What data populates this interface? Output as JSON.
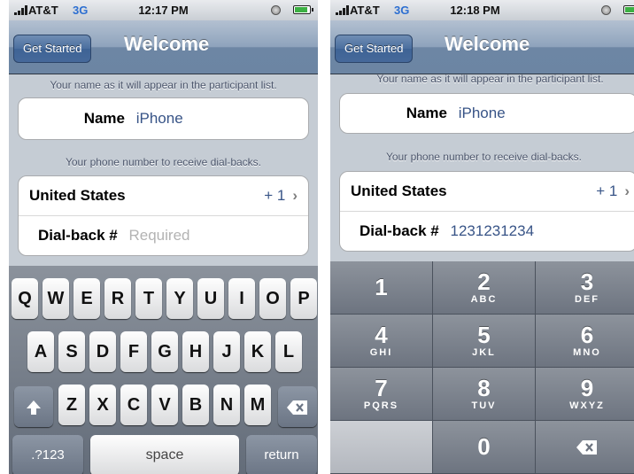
{
  "left": {
    "status": {
      "carrier": "AT&T",
      "network": "3G",
      "time": "12:17 PM"
    },
    "nav": {
      "button": "Get Started",
      "title": "Welcome"
    },
    "name_hint": "Your name as it will appear in the participant list.",
    "name": {
      "label": "Name",
      "value": "iPhone"
    },
    "phone_hint": "Your phone number to receive dial-backs.",
    "country": {
      "label": "United States",
      "code": "+ 1"
    },
    "dialback": {
      "label": "Dial-back #",
      "placeholder": "Required"
    },
    "keyboard": {
      "row1": [
        "Q",
        "W",
        "E",
        "R",
        "T",
        "Y",
        "U",
        "I",
        "O",
        "P"
      ],
      "row2": [
        "A",
        "S",
        "D",
        "F",
        "G",
        "H",
        "J",
        "K",
        "L"
      ],
      "row3": [
        "Z",
        "X",
        "C",
        "V",
        "B",
        "N",
        "M"
      ],
      "mode_key": ".?123",
      "space_key": "space",
      "return_key": "return"
    }
  },
  "right": {
    "status": {
      "carrier": "AT&T",
      "network": "3G",
      "time": "12:18 PM"
    },
    "nav": {
      "button": "Get Started",
      "title": "Welcome"
    },
    "name_hint": "Your name as it will appear in the participant list.",
    "name": {
      "label": "Name",
      "value": "iPhone"
    },
    "phone_hint": "Your phone number to receive dial-backs.",
    "country": {
      "label": "United States",
      "code": "+ 1"
    },
    "dialback": {
      "label": "Dial-back #",
      "value": "1231231234"
    },
    "keypad": [
      {
        "digit": "1",
        "letters": ""
      },
      {
        "digit": "2",
        "letters": "ABC"
      },
      {
        "digit": "3",
        "letters": "DEF"
      },
      {
        "digit": "4",
        "letters": "GHI"
      },
      {
        "digit": "5",
        "letters": "JKL"
      },
      {
        "digit": "6",
        "letters": "MNO"
      },
      {
        "digit": "7",
        "letters": "PQRS"
      },
      {
        "digit": "8",
        "letters": "TUV"
      },
      {
        "digit": "9",
        "letters": "WXYZ"
      },
      {
        "digit": "",
        "letters": ""
      },
      {
        "digit": "0",
        "letters": ""
      },
      {
        "digit": "",
        "letters": ""
      }
    ]
  },
  "icons": {
    "shift": "shift-arrow-icon",
    "delete": "backspace-icon",
    "chevron": "chevron-right-icon"
  }
}
